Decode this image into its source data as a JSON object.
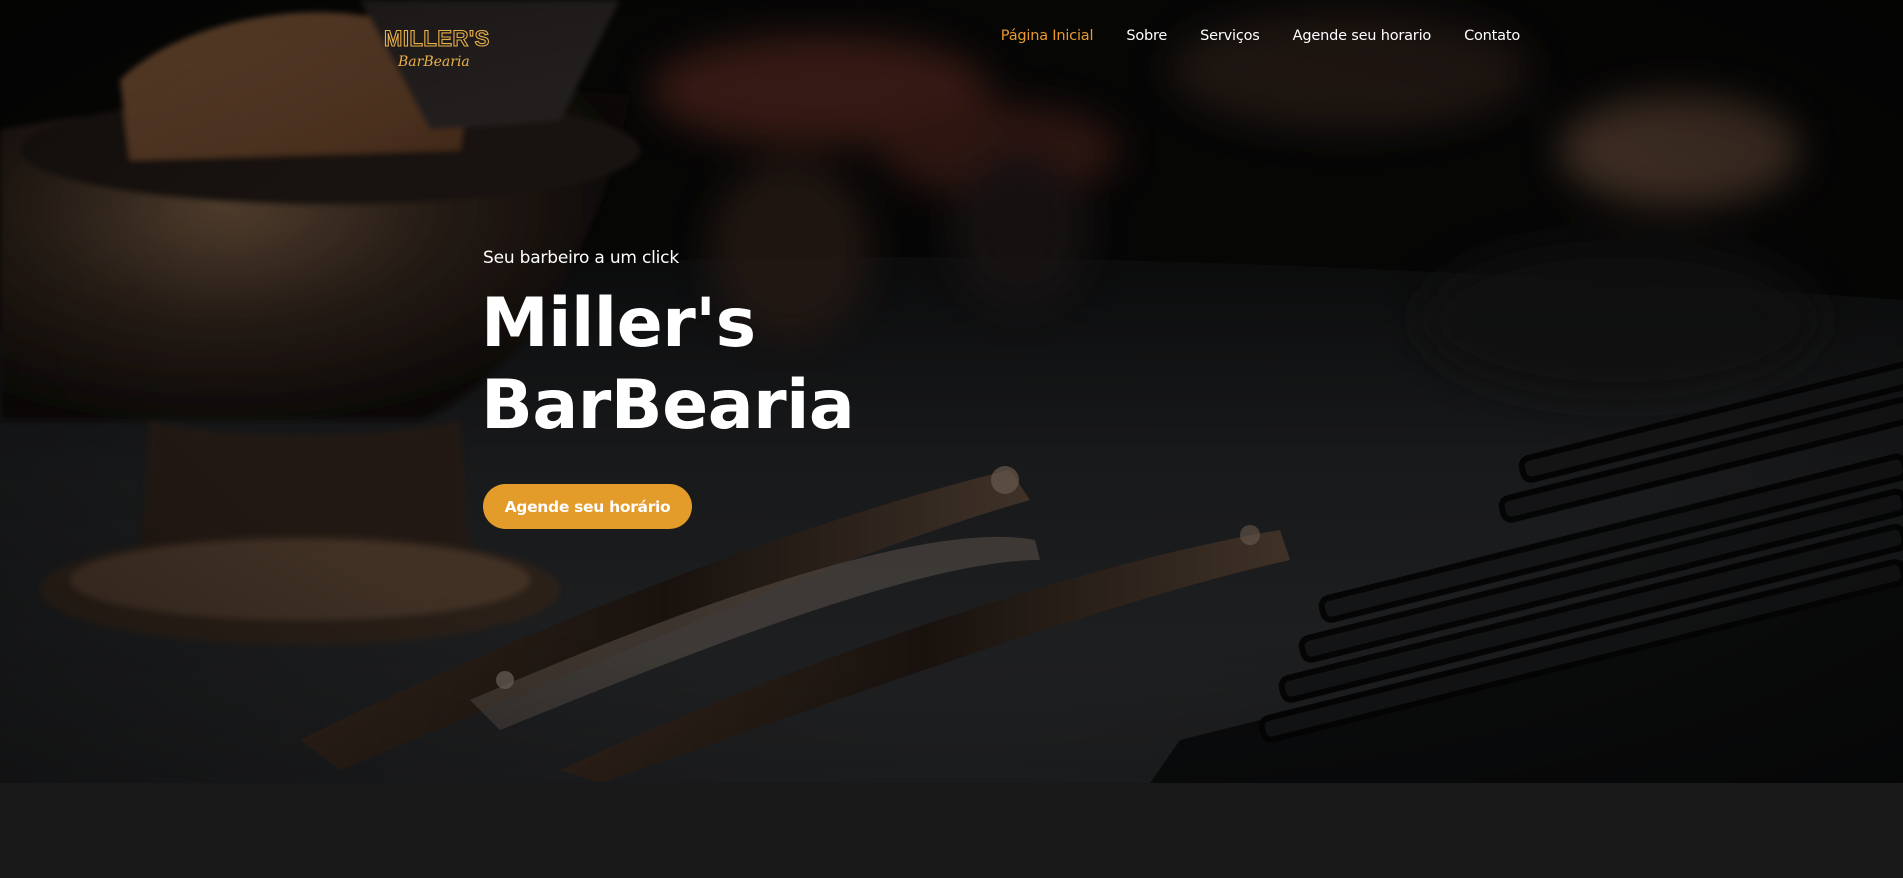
{
  "brand": {
    "logo_line1": "MILLER'S",
    "logo_line2": "BarBearia",
    "logo_color": "#e9b04a"
  },
  "nav": {
    "items": [
      {
        "label": "Página Inicial",
        "active": true
      },
      {
        "label": "Sobre",
        "active": false
      },
      {
        "label": "Serviços",
        "active": false
      },
      {
        "label": "Agende seu horario",
        "active": false
      },
      {
        "label": "Contato",
        "active": false
      }
    ],
    "active_color": "#e89a2e"
  },
  "hero": {
    "tagline": "Seu barbeiro a um click",
    "title_line1": "Miller's",
    "title_line2": "BarBearia",
    "cta_label": "Agende seu horário",
    "accent": "#e39b29"
  },
  "icons": {
    "logo": "barbershop-logo-icon",
    "background": "barber-tools-photo"
  }
}
